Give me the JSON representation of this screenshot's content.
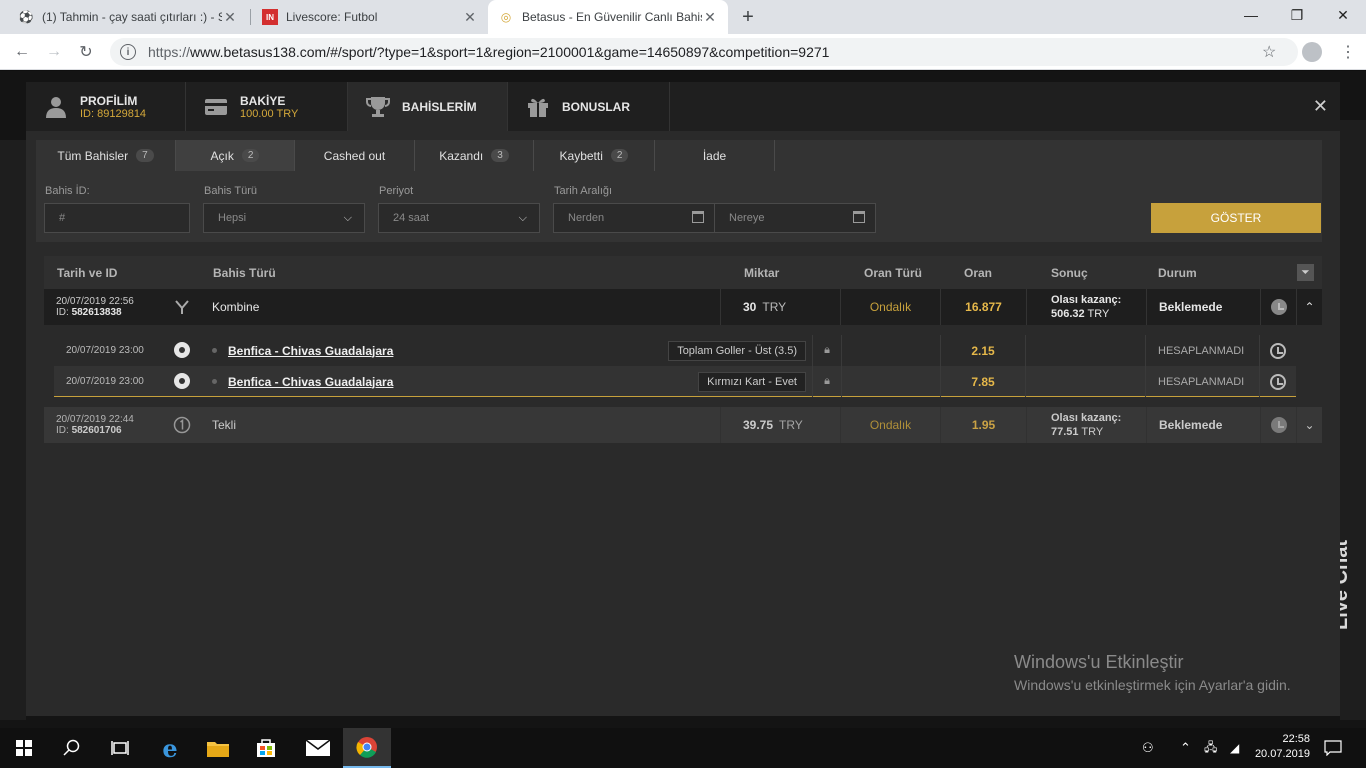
{
  "browser": {
    "tabs": [
      {
        "title": "(1) Tahmin - çay saati çıtırları :) - S",
        "icon": "soccer-ball-icon"
      },
      {
        "title": "Livescore: Futbol",
        "icon": "livescore-icon"
      },
      {
        "title": "Betasus - En Güvenilir Canlı Bahis",
        "icon": "betasus-icon"
      }
    ],
    "url_scheme": "https://",
    "url_rest": "www.betasus138.com/#/sport/?type=1&sport=1&region=2100001&game=14650897&competition=9271"
  },
  "modal": {
    "tabs": [
      {
        "label": "PROFİLİM",
        "sub": "ID: 89129814",
        "icon": "user-icon"
      },
      {
        "label": "BAKİYE",
        "sub": "100.00 TRY",
        "icon": "wallet-icon"
      },
      {
        "label": "BAHİSLERİM",
        "sub": "",
        "icon": "trophy-icon"
      },
      {
        "label": "BONUSLAR",
        "sub": "",
        "icon": "gift-icon"
      }
    ],
    "filter_tabs": [
      {
        "label": "Tüm Bahisler",
        "count": "7"
      },
      {
        "label": "Açık",
        "count": "2"
      },
      {
        "label": "Cashed out",
        "count": ""
      },
      {
        "label": "Kazandı",
        "count": "3"
      },
      {
        "label": "Kaybetti",
        "count": "2"
      },
      {
        "label": "İade",
        "count": ""
      }
    ],
    "filters": {
      "bet_id_label": "Bahis İD:",
      "bet_id_placeholder": "#",
      "bet_type_label": "Bahis Türü",
      "bet_type_value": "Hepsi",
      "period_label": "Periyot",
      "period_value": "24 saat",
      "date_range_label": "Tarih Aralığı",
      "from_placeholder": "Nerden",
      "to_placeholder": "Nereye",
      "show_button": "GÖSTER"
    },
    "table_headers": {
      "date_id": "Tarih ve ID",
      "bet_type": "Bahis Türü",
      "amount": "Miktar",
      "odd_type": "Oran Türü",
      "odd": "Oran",
      "result": "Sonuç",
      "status": "Durum"
    },
    "bets": [
      {
        "date": "20/07/2019 22:56",
        "id_label": "ID:",
        "id": "582613838",
        "type": "Kombine",
        "amount": "30",
        "currency": "TRY",
        "odd_type": "Ondalık",
        "odd": "16.877",
        "result_label": "Olası kazanç:",
        "result_value": "506.32",
        "result_currency": "TRY",
        "status": "Beklemede",
        "selections": [
          {
            "date": "20/07/2019 23:00",
            "match": "Benfica - Chivas Guadalajara",
            "market": "Toplam Goller - Üst (3.5)",
            "odd": "2.15",
            "status": "HESAPLANMADI"
          },
          {
            "date": "20/07/2019 23:00",
            "match": "Benfica - Chivas Guadalajara",
            "market": "Kırmızı Kart - Evet",
            "odd": "7.85",
            "status": "HESAPLANMADI"
          }
        ]
      },
      {
        "date": "20/07/2019 22:44",
        "id_label": "ID:",
        "id": "582601706",
        "type": "Tekli",
        "amount": "39.75",
        "currency": "TRY",
        "odd_type": "Ondalık",
        "odd": "1.95",
        "result_label": "Olası kazanç:",
        "result_value": "77.51",
        "result_currency": "TRY",
        "status": "Beklemede"
      }
    ]
  },
  "watermark": {
    "title": "Windows'u Etkinleştir",
    "subtitle": "Windows'u etkinleştirmek için Ayarlar'a gidin."
  },
  "side": {
    "live_chat": "Live Chat"
  },
  "taskbar": {
    "time": "22:58",
    "date": "20.07.2019"
  }
}
